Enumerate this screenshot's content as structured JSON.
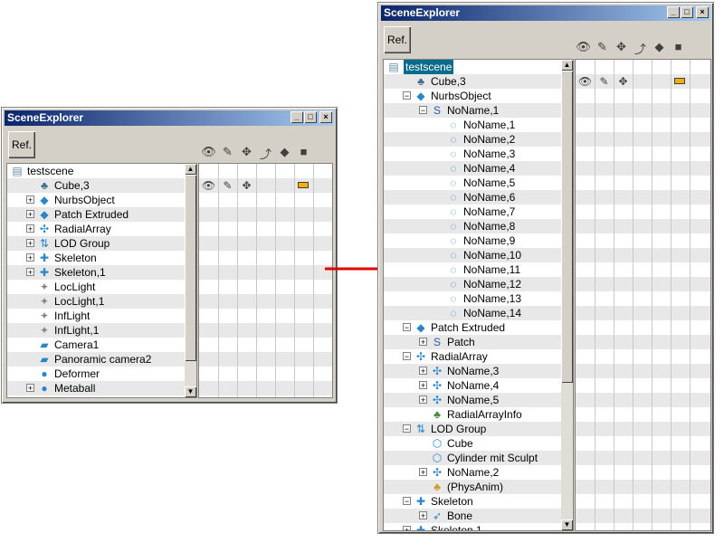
{
  "window_title": "SceneExplorer",
  "ref_label": "Ref.",
  "title_buttons": {
    "minimize": "_",
    "maximize": "□",
    "close": "×"
  },
  "column_icons": [
    "eye-icon",
    "select-icon",
    "lock-icon",
    "wire-icon",
    "mode-icon",
    "color-icon"
  ],
  "column_glyphs": [
    "👁",
    "✎",
    "✥",
    "⤴",
    "◆",
    "■"
  ],
  "swatch_color": "#f0b000",
  "arrow_color": "#e00000",
  "small": {
    "rows": [
      {
        "label": "testscene",
        "exp": "",
        "icon": "▤",
        "color": "#6a8ca0"
      },
      {
        "label": "Cube,3",
        "exp": "",
        "icon": "♣",
        "color": "#3a6a8a",
        "props": true
      },
      {
        "label": "NurbsObject",
        "exp": "+",
        "icon": "◆",
        "color": "#2a86c8"
      },
      {
        "label": "Patch Extruded",
        "exp": "+",
        "icon": "◆",
        "color": "#2a86c8"
      },
      {
        "label": "RadialArray",
        "exp": "+",
        "icon": "✣",
        "color": "#2a86c8"
      },
      {
        "label": "LOD Group",
        "exp": "+",
        "icon": "⇅",
        "color": "#2a86c8"
      },
      {
        "label": "Skeleton",
        "exp": "+",
        "icon": "✚",
        "color": "#2a86c8"
      },
      {
        "label": "Skeleton,1",
        "exp": "+",
        "icon": "✚",
        "color": "#2a86c8"
      },
      {
        "label": "LocLight",
        "exp": "",
        "icon": "✦",
        "color": "#888888"
      },
      {
        "label": "LocLight,1",
        "exp": "",
        "icon": "✦",
        "color": "#888888"
      },
      {
        "label": "InfLight",
        "exp": "",
        "icon": "✦",
        "color": "#888888"
      },
      {
        "label": "InfLight,1",
        "exp": "",
        "icon": "✦",
        "color": "#888888"
      },
      {
        "label": "Camera1",
        "exp": "",
        "icon": "▰",
        "color": "#2a86c8"
      },
      {
        "label": "Panoramic camera2",
        "exp": "",
        "icon": "▰",
        "color": "#2a86c8"
      },
      {
        "label": "Deformer",
        "exp": "",
        "icon": "●",
        "color": "#2a86c8"
      },
      {
        "label": "Metaball",
        "exp": "+",
        "icon": "●",
        "color": "#2a86c8"
      }
    ]
  },
  "large": {
    "rows": [
      {
        "label": "testscene",
        "depth": 0,
        "exp": "",
        "icon": "▤",
        "color": "#6a8ca0",
        "selected": true
      },
      {
        "label": "Cube,3",
        "depth": 1,
        "exp": "",
        "icon": "♣",
        "color": "#3a6a8a",
        "props": true
      },
      {
        "label": "NurbsObject",
        "depth": 1,
        "exp": "−",
        "icon": "◆",
        "color": "#2a86c8"
      },
      {
        "label": "NoName,1",
        "depth": 2,
        "exp": "−",
        "icon": "S",
        "color": "#2a5aa8"
      },
      {
        "label": "NoName,1",
        "depth": 3,
        "exp": "",
        "icon": "◌",
        "color": "#2a86c8"
      },
      {
        "label": "NoName,2",
        "depth": 3,
        "exp": "",
        "icon": "◌",
        "color": "#2a86c8"
      },
      {
        "label": "NoName,3",
        "depth": 3,
        "exp": "",
        "icon": "◌",
        "color": "#2a86c8"
      },
      {
        "label": "NoName,4",
        "depth": 3,
        "exp": "",
        "icon": "◌",
        "color": "#2a86c8"
      },
      {
        "label": "NoName,5",
        "depth": 3,
        "exp": "",
        "icon": "◌",
        "color": "#2a86c8"
      },
      {
        "label": "NoName,6",
        "depth": 3,
        "exp": "",
        "icon": "◌",
        "color": "#2a86c8"
      },
      {
        "label": "NoName,7",
        "depth": 3,
        "exp": "",
        "icon": "◌",
        "color": "#2a86c8"
      },
      {
        "label": "NoName,8",
        "depth": 3,
        "exp": "",
        "icon": "◌",
        "color": "#2a86c8"
      },
      {
        "label": "NoName,9",
        "depth": 3,
        "exp": "",
        "icon": "◌",
        "color": "#2a86c8"
      },
      {
        "label": "NoName,10",
        "depth": 3,
        "exp": "",
        "icon": "◌",
        "color": "#2a86c8"
      },
      {
        "label": "NoName,11",
        "depth": 3,
        "exp": "",
        "icon": "◌",
        "color": "#2a86c8"
      },
      {
        "label": "NoName,12",
        "depth": 3,
        "exp": "",
        "icon": "◌",
        "color": "#2a86c8"
      },
      {
        "label": "NoName,13",
        "depth": 3,
        "exp": "",
        "icon": "◌",
        "color": "#2a86c8"
      },
      {
        "label": "NoName,14",
        "depth": 3,
        "exp": "",
        "icon": "◌",
        "color": "#2a86c8"
      },
      {
        "label": "Patch Extruded",
        "depth": 1,
        "exp": "−",
        "icon": "◆",
        "color": "#2a86c8"
      },
      {
        "label": "Patch",
        "depth": 2,
        "exp": "+",
        "icon": "S",
        "color": "#2a5aa8"
      },
      {
        "label": "RadialArray",
        "depth": 1,
        "exp": "−",
        "icon": "✣",
        "color": "#2a86c8"
      },
      {
        "label": "NoName,3",
        "depth": 2,
        "exp": "+",
        "icon": "✣",
        "color": "#2a86c8"
      },
      {
        "label": "NoName,4",
        "depth": 2,
        "exp": "+",
        "icon": "✣",
        "color": "#2a86c8"
      },
      {
        "label": "NoName,5",
        "depth": 2,
        "exp": "+",
        "icon": "✣",
        "color": "#2a86c8"
      },
      {
        "label": "RadialArrayInfo",
        "depth": 2,
        "exp": "",
        "icon": "♣",
        "color": "#3a8a3a"
      },
      {
        "label": "LOD Group",
        "depth": 1,
        "exp": "−",
        "icon": "⇅",
        "color": "#2a86c8"
      },
      {
        "label": "Cube",
        "depth": 2,
        "exp": "",
        "icon": "⬡",
        "color": "#2a86c8"
      },
      {
        "label": "Cylinder mit Sculpt",
        "depth": 2,
        "exp": "",
        "icon": "⬡",
        "color": "#2a86c8"
      },
      {
        "label": "NoName,2",
        "depth": 2,
        "exp": "+",
        "icon": "✣",
        "color": "#2a86c8"
      },
      {
        "label": "(PhysAnim)",
        "depth": 2,
        "exp": "",
        "icon": "♣",
        "color": "#c89a20"
      },
      {
        "label": "Skeleton",
        "depth": 1,
        "exp": "−",
        "icon": "✚",
        "color": "#2a86c8"
      },
      {
        "label": "Bone",
        "depth": 2,
        "exp": "+",
        "icon": "➶",
        "color": "#2a86c8"
      },
      {
        "label": "Skeleton,1",
        "depth": 1,
        "exp": "+",
        "icon": "✚",
        "color": "#2a86c8"
      }
    ]
  }
}
